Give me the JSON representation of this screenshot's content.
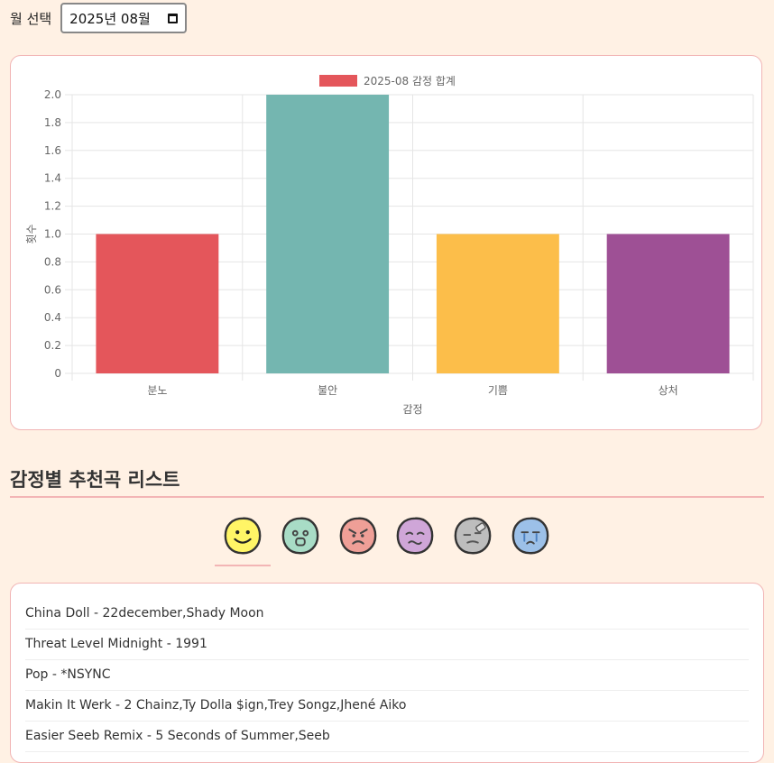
{
  "month_picker": {
    "label": "월 선택",
    "value": "2025년 08월"
  },
  "chart_data": {
    "type": "bar",
    "legend": "2025-08 감정 합계",
    "categories": [
      "분노",
      "불안",
      "기쁨",
      "상처"
    ],
    "values": [
      1,
      2,
      1,
      1
    ],
    "colors": [
      "#e4565b",
      "#74b6b0",
      "#fcbe4a",
      "#9e5095"
    ],
    "xlabel": "감정",
    "ylabel": "횟수",
    "ylim": [
      0,
      2
    ],
    "yticks": [
      "0",
      "0.2",
      "0.4",
      "0.6",
      "0.8",
      "1.0",
      "1.2",
      "1.4",
      "1.6",
      "1.8",
      "2.0"
    ],
    "grid": true,
    "legend_position": "top"
  },
  "section": {
    "title": "감정별 추천곡 리스트"
  },
  "emotions": [
    {
      "icon": "happy-face-icon",
      "color": "#fff566",
      "active": true
    },
    {
      "icon": "surprised-face-icon",
      "color": "#a8dcc6",
      "active": false
    },
    {
      "icon": "angry-face-icon",
      "color": "#ef9f97",
      "active": false
    },
    {
      "icon": "worried-face-icon",
      "color": "#cfa6d8",
      "active": false
    },
    {
      "icon": "hurt-face-icon",
      "color": "#bdbdbd",
      "active": false
    },
    {
      "icon": "crying-face-icon",
      "color": "#9cc0e8",
      "active": false
    }
  ],
  "songs": [
    "China Doll - 22december,Shady Moon",
    "Threat Level Midnight - 1991",
    "Pop - *NSYNC",
    "Makin It Werk - 2 Chainz,Ty Dolla $ign,Trey Songz,Jhené Aiko",
    "Easier Seeb Remix - 5 Seconds of Summer,Seeb"
  ]
}
